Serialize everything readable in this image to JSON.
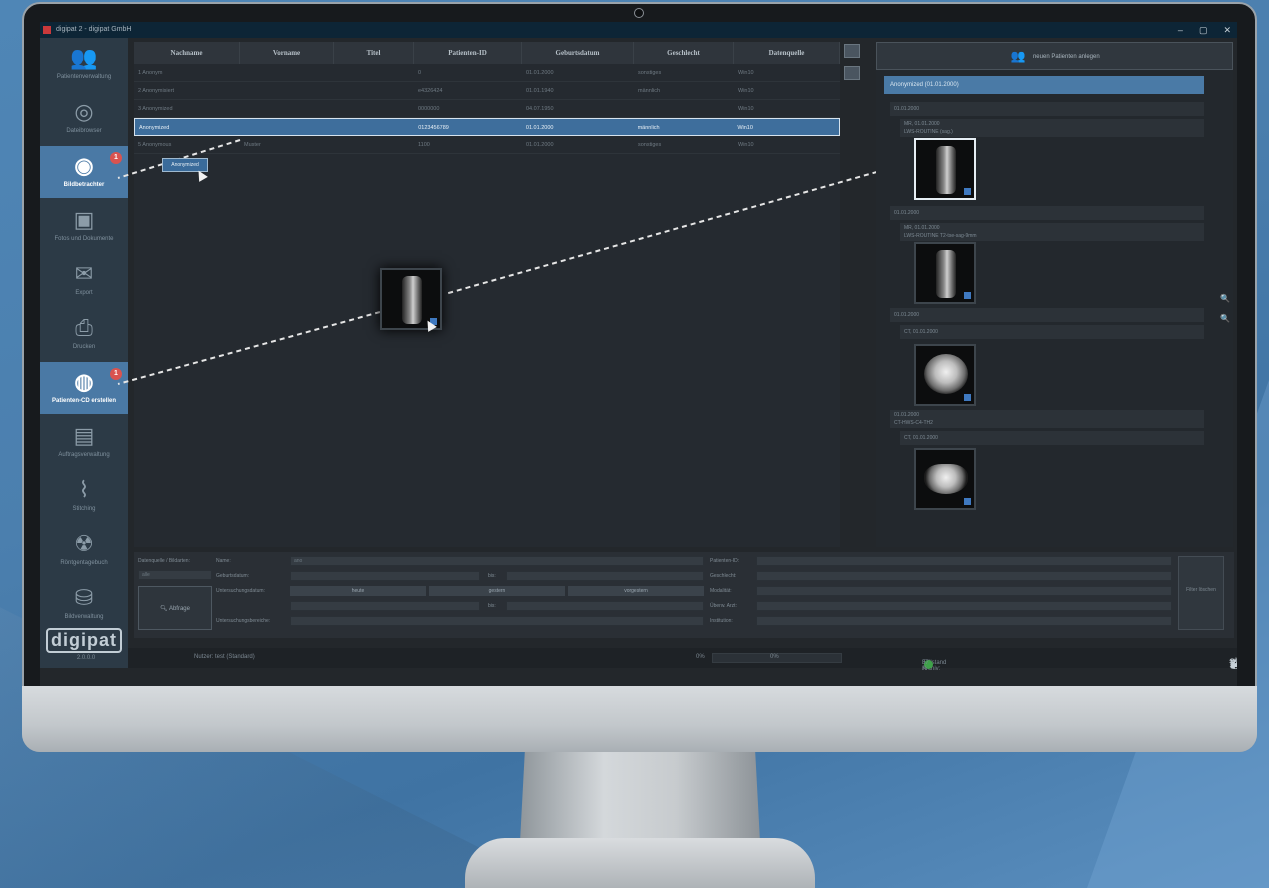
{
  "window": {
    "title": "digipat 2 - digipat GmbH",
    "controls": [
      "–",
      "▢",
      "✕"
    ]
  },
  "sidebar": {
    "items": [
      {
        "label": "Patientenverwaltung",
        "icon": "patients-icon",
        "active": false,
        "badge": ""
      },
      {
        "label": "Dateibrowser",
        "icon": "file-browser-icon",
        "active": false,
        "badge": ""
      },
      {
        "label": "Bildbetrachter",
        "icon": "eye-icon",
        "active": true,
        "badge": "1"
      },
      {
        "label": "Fotos und Dokumente",
        "icon": "photos-icon",
        "active": false,
        "badge": ""
      },
      {
        "label": "Export",
        "icon": "export-icon",
        "active": false,
        "badge": ""
      },
      {
        "label": "Drucken",
        "icon": "print-icon",
        "active": false,
        "badge": ""
      },
      {
        "label": "Patienten-CD erstellen",
        "icon": "cd-icon",
        "active": true,
        "badge": "1"
      },
      {
        "label": "Auftragsverwaltung",
        "icon": "clipboard-icon",
        "active": false,
        "badge": ""
      },
      {
        "label": "Stitching",
        "icon": "stitching-icon",
        "active": false,
        "badge": ""
      },
      {
        "label": "Röntgentagebuch",
        "icon": "xray-diary-icon",
        "active": false,
        "badge": ""
      },
      {
        "label": "Bildverwaltung",
        "icon": "image-manage-icon",
        "active": false,
        "badge": ""
      }
    ],
    "brand": "digipat",
    "version": "2.0.0.0"
  },
  "table": {
    "columns": [
      "Nachname",
      "Vorname",
      "Titel",
      "Patienten-ID",
      "Geburtsdatum",
      "Geschlecht",
      "Datenquelle"
    ],
    "rows": [
      [
        "1 Anonym",
        "",
        "",
        "0",
        "01.01.2000",
        "sonstiges",
        "Win10"
      ],
      [
        "2 Anonymisiert",
        "",
        "",
        "e4326424",
        "01.01.1940",
        "männlich",
        "Win10"
      ],
      [
        "3 Anonymized",
        "",
        "",
        "0000000",
        "04.07.1950",
        "",
        "Win10"
      ],
      [
        "Anonymized",
        "",
        "",
        "0123456789",
        "01.01.2000",
        "männlich",
        "Win10"
      ],
      [
        "5 Anonymous",
        "Muster",
        "",
        "1100",
        "01.01.2000",
        "sonstiges",
        "Win10"
      ]
    ],
    "selected_row": 3,
    "drag_label": "Anonymized"
  },
  "right_panel": {
    "new_patient": "neuen Patienten anlegen",
    "tree_header": "Anonymized (01.01.2000)",
    "studies": [
      {
        "date": "01.01.2000",
        "series": "MR, 01.01.2000",
        "desc": "LWS-ROUTINE (sag.)"
      },
      {
        "date": "01.01.2000",
        "series": "MR, 01.01.2000",
        "desc": "LWS-ROUTINE T2-tse-sag-9mm"
      },
      {
        "date": "01.01.2000",
        "series": "CT, 01.01.2000",
        "desc": ""
      },
      {
        "date": "01.01.2000",
        "series": "CT, 01.01.2000",
        "desc": "CT-HWS-C4-TH2"
      }
    ]
  },
  "search": {
    "source_label": "Datenquelle / Bildarten:",
    "source_value": "alle",
    "query_button": "Abfrage",
    "name_label": "Name:",
    "name_value": "ano",
    "birth_label": "Geburtsdatum:",
    "exam_date_label": "Untersuchungsdatum:",
    "exam_area_label": "Untersuchungsbereiche:",
    "until_label": "bis:",
    "today": "heute",
    "yesterday": "gestern",
    "day_before": "vorgestern",
    "patient_id_label": "Patienten-ID:",
    "gender_label": "Geschlecht:",
    "modality_label": "Modalität:",
    "referrer_label": "Überw. Arzt:",
    "institution_label": "Institution:",
    "filter_button": "Filter löschen"
  },
  "statusbar": {
    "user": "Nutzer: test (Standard)",
    "progress_left": "0%",
    "progress_right": "0%",
    "disk_label": "Füllstand Archiv:",
    "disk_value": "37 %"
  }
}
